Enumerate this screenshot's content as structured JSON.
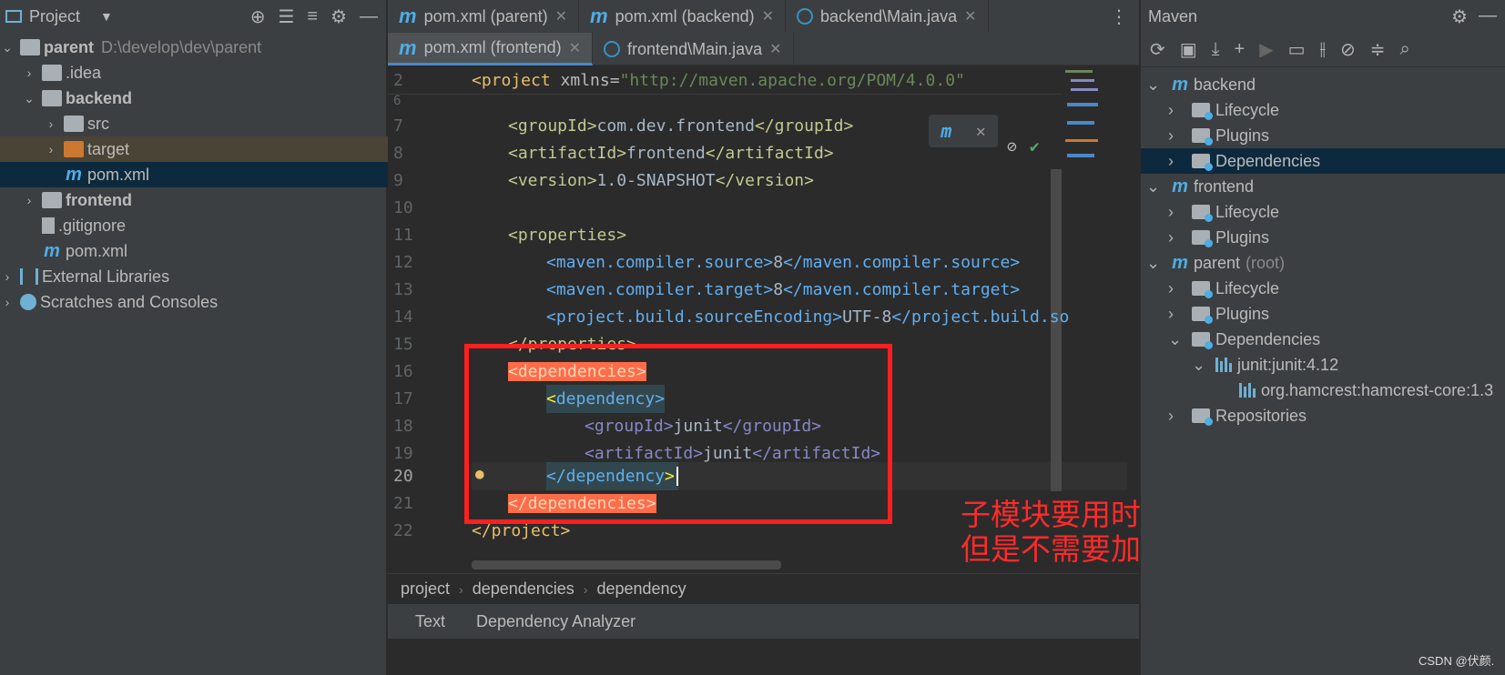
{
  "project": {
    "title": "Project",
    "tree": [
      {
        "label": "parent",
        "sub": "D:\\develop\\dev\\parent",
        "bold": true
      },
      {
        "label": ".idea"
      },
      {
        "label": "backend",
        "bold": true
      },
      {
        "label": "src"
      },
      {
        "label": "target"
      },
      {
        "label": "pom.xml"
      },
      {
        "label": "frontend",
        "bold": true
      },
      {
        "label": ".gitignore"
      },
      {
        "label": "pom.xml"
      },
      {
        "label": "External Libraries"
      },
      {
        "label": "Scratches and Consoles"
      }
    ]
  },
  "tabs_row1": [
    "pom.xml (parent)",
    "pom.xml (backend)",
    "backend\\Main.java"
  ],
  "tabs_row2": [
    "pom.xml (frontend)",
    "frontend\\Main.java"
  ],
  "sticky": {
    "num": "2",
    "text_tag": "<project ",
    "text_attr": "xmlns=",
    "text_str": "\"http://maven.apache.org/POM/4.0.0\""
  },
  "lines": {
    "n6": "6",
    "n7": "7",
    "n8": "8",
    "n9": "9",
    "n10": "10",
    "n11": "11",
    "n12": "12",
    "n13": "13",
    "n14": "14",
    "n15": "15",
    "n16": "16",
    "n17": "17",
    "n18": "18",
    "n19": "19",
    "n20": "20",
    "n21": "21",
    "n22": "22",
    "l7_open": "<groupId>",
    "l7_val": "com.dev.frontend",
    "l7_close": "</groupId>",
    "l8_open": "<artifactId>",
    "l8_val": "frontend",
    "l8_close": "</artifactId>",
    "l9_open": "<version>",
    "l9_val": "1.0-SNAPSHOT",
    "l9_close": "</version>",
    "l11": "<properties>",
    "l12_open": "<maven.compiler.source>",
    "l12_val": "8",
    "l12_close": "</maven.compiler.source>",
    "l13_open": "<maven.compiler.target>",
    "l13_val": "8",
    "l13_close": "</maven.compiler.target>",
    "l14_open": "<project.build.sourceEncoding>",
    "l14_val": "UTF-8",
    "l14_close": "</project.build.so",
    "l15": "</properties>",
    "l16": "<dependencies>",
    "l17_lt": "<",
    "l17_name": "dependency>",
    "l18_open": "<groupId>",
    "l18_val": "junit",
    "l18_close": "</groupId>",
    "l19_open": "<artifactId>",
    "l19_val": "junit",
    "l19_close": "</artifactId>",
    "l20_name": "</dependency",
    "l20_gt": ">",
    "l21": "</dependencies>",
    "l22": "</project>"
  },
  "breadcrumb": [
    "project",
    "dependencies",
    "dependency"
  ],
  "bottom_tabs": [
    "Text",
    "Dependency Analyzer"
  ],
  "annotation": {
    "line1": "子模块要用时加上",
    "line2": "但是不需要加版本号了"
  },
  "maven": {
    "title": "Maven",
    "tree": [
      {
        "label": "backend"
      },
      {
        "label": "Lifecycle"
      },
      {
        "label": "Plugins"
      },
      {
        "label": "Dependencies"
      },
      {
        "label": "frontend"
      },
      {
        "label": "Lifecycle"
      },
      {
        "label": "Plugins"
      },
      {
        "label": "parent",
        "sub": "(root)"
      },
      {
        "label": "Lifecycle"
      },
      {
        "label": "Plugins"
      },
      {
        "label": "Dependencies"
      },
      {
        "label": "junit:junit:4.12"
      },
      {
        "label": "org.hamcrest:hamcrest-core:1.3"
      },
      {
        "label": "Repositories"
      }
    ]
  },
  "watermark": "CSDN @伏颜.",
  "colors": {
    "accent": "#4a88c7",
    "selection": "#0d293e",
    "highlight": "#ff6c4a",
    "annotation": "#ff1f1f"
  }
}
